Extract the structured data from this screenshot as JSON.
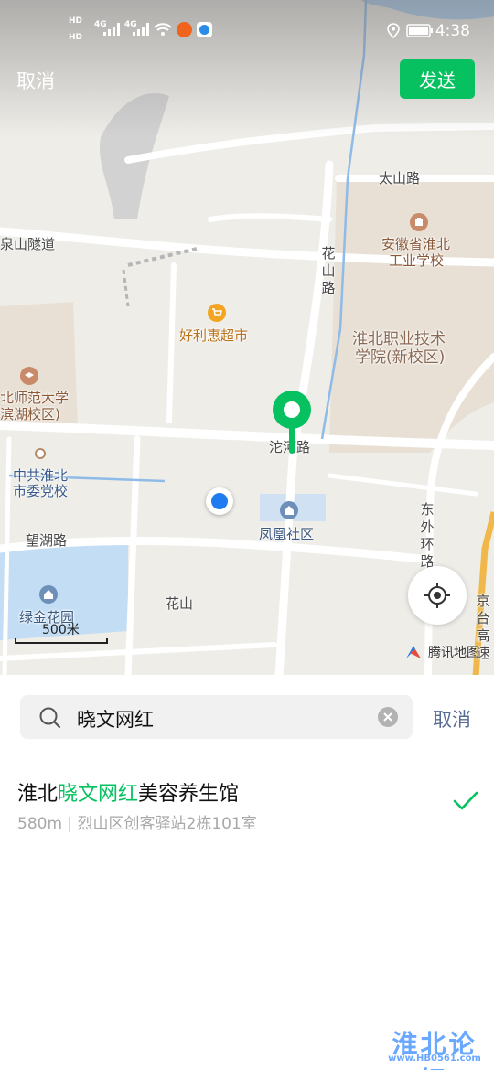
{
  "status_bar": {
    "time": "4:38",
    "hd1": "HD",
    "hd2": "HD",
    "net1": "4G",
    "net2": "4G"
  },
  "header": {
    "cancel_label": "取消",
    "send_label": "发送"
  },
  "map": {
    "labels": {
      "taishan_road": "太山路",
      "anhui_school_line1": "安徽省淮北",
      "anhui_school_line2": "工业学校",
      "quanshan_tunnel": "泉山隧道",
      "huashan_road": "花山路",
      "haolihui": "好利惠超市",
      "vocational_line1": "淮北职业技术",
      "vocational_line2": "学院(新校区)",
      "normal_univ_line1": "北师范大学",
      "normal_univ_line2": "滨湖校区)",
      "tuohe_road": "沱河路",
      "party_school_line1": "中共淮北",
      "party_school_line2": "市委党校",
      "dongwaihuan_road": "东外环路",
      "fenghuang": "凤凰社区",
      "wanghu_road": "望湖路",
      "jinghu_garden": "绿金花园",
      "huashan": "花山",
      "jingtai_expressway": "京台高速"
    },
    "scale_label": "500米",
    "provider": "腾讯地图",
    "icons": {
      "pin": "location-pin-icon",
      "my_location": "my-location-dot",
      "locate": "crosshair-icon"
    },
    "colors": {
      "pin": "#07c160",
      "my_location": "#1f7cf0"
    }
  },
  "search": {
    "query": "晓文网红",
    "cancel_label": "取消"
  },
  "results": [
    {
      "title_prefix": "淮北",
      "title_highlight": "晓文网红",
      "title_suffix": "美容养生馆",
      "subtitle": "580m | 烈山区创客驿站2栋101室",
      "selected": true
    }
  ],
  "watermark": {
    "big": "淮北论坛",
    "small": "www.HB0561.com"
  },
  "accent_colors": {
    "send": "#07c160",
    "link": "#576b95"
  }
}
